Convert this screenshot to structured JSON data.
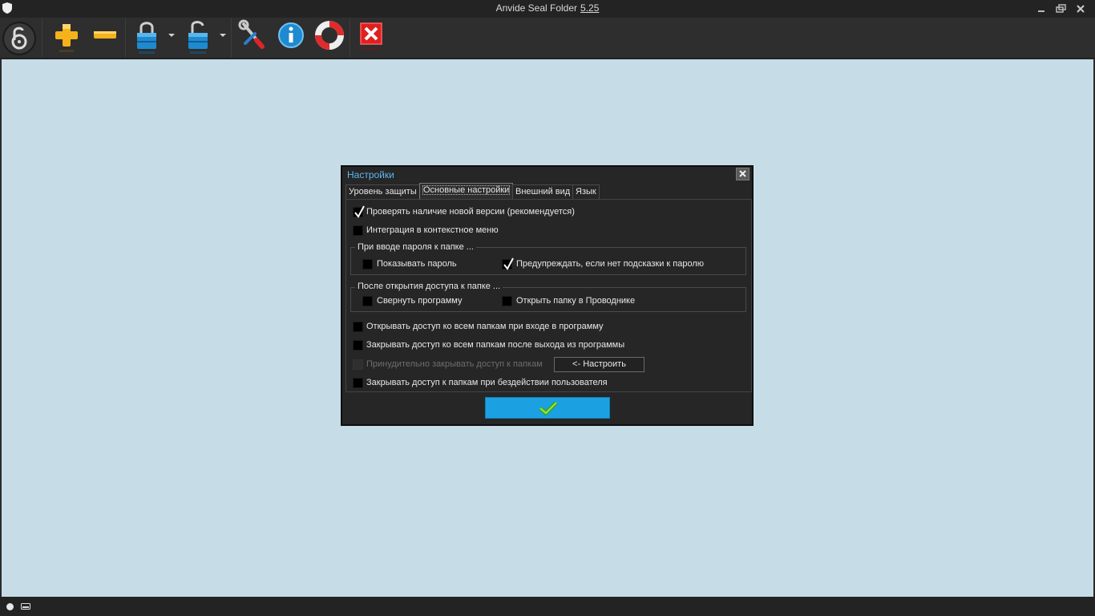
{
  "window": {
    "title": "Anvide Seal Folder",
    "version": "5.25",
    "icon": "shield-icon",
    "controls": {
      "minimize": "minimize-icon",
      "restore": "restore-icon",
      "close": "close-icon"
    }
  },
  "toolbar": {
    "items": [
      {
        "icon": "logo-lock-icon"
      },
      {
        "icon": "add-folder-icon"
      },
      {
        "icon": "remove-folder-icon"
      },
      {
        "icon": "lock-icon"
      },
      {
        "icon": "unlock-icon"
      },
      {
        "icon": "settings-tools-icon"
      },
      {
        "icon": "info-icon"
      },
      {
        "icon": "help-lifebuoy-icon"
      },
      {
        "icon": "exit-icon"
      }
    ]
  },
  "dialog": {
    "title": "Настройки",
    "tabs": [
      "Уровень защиты",
      "Основные настройки",
      "Внешний вид",
      "Язык"
    ],
    "active_tab": "Основные настройки",
    "options": {
      "check_updates": {
        "label": "Проверять наличие новой версии  (рекомендуется)",
        "checked": true
      },
      "context_menu": {
        "label": "Интеграция в контекстное меню",
        "checked": false
      }
    },
    "group_password": {
      "title": "При вводе пароля к папке ...",
      "show_password": {
        "label": "Показывать пароль",
        "checked": false
      },
      "warn_no_hint": {
        "label": "Предупреждать, если нет подсказки к паролю",
        "checked": true
      }
    },
    "group_after_open": {
      "title": "После открытия доступа к папке ...",
      "minimize": {
        "label": "Свернуть программу",
        "checked": false
      },
      "open_explorer": {
        "label": "Открыть папку в Проводнике",
        "checked": false
      }
    },
    "bottom_options": {
      "open_all_on_start": {
        "label": "Открывать доступ ко всем папкам при входе в программу",
        "checked": false
      },
      "close_all_on_exit": {
        "label": "Закрывать доступ ко всем папкам после выхода из программы",
        "checked": false
      },
      "force_close": {
        "label": "Принудительно закрывать доступ к папкам",
        "checked": false,
        "disabled": true
      },
      "configure_button": "<- Настроить",
      "close_on_idle": {
        "label": "Закрывать доступ к папкам при бездействии пользователя",
        "checked": false
      }
    },
    "ok_icon": "checkmark-icon"
  },
  "colors": {
    "workspace_bg": "#c6dde8",
    "accent": "#1ba1e2",
    "title_text": "#5cb8f0"
  }
}
